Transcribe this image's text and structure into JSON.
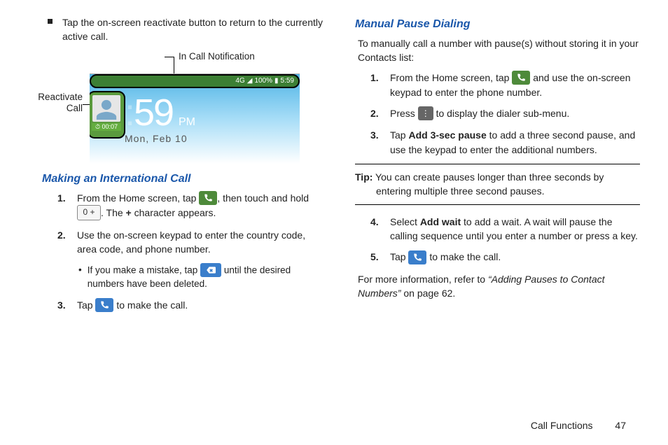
{
  "left": {
    "topBullet": "Tap the on-screen reactivate button to return to the currently active call.",
    "figure": {
      "callout_top": "In Call Notification",
      "callout_left_line1": "Reactivate",
      "callout_left_line2": "Call",
      "status_right": "100%",
      "status_time": "5:59",
      "status_4g": "4G",
      "timer": "00:07",
      "clock_partial": "59",
      "clock_pm": "PM",
      "clock_date": "Mon, Feb 10"
    },
    "heading": "Making an International Call",
    "steps": {
      "s1_a": "From the Home screen, tap ",
      "s1_b": ", then touch and hold ",
      "s1_c": ". The ",
      "s1_plus": "+",
      "s1_d": " character appears.",
      "key_0plus": "0 +",
      "s2": "Use the on-screen keypad to enter the country code, area code, and phone number.",
      "s2_sub_a": "If you make a mistake, tap ",
      "s2_sub_b": " until the desired numbers have been deleted.",
      "s3_a": "Tap ",
      "s3_b": " to make the call."
    }
  },
  "right": {
    "heading": "Manual Pause Dialing",
    "intro": "To manually call a number with pause(s) without storing it in your Contacts list:",
    "s1_a": "From the Home screen, tap ",
    "s1_b": " and use the on-screen keypad to enter the phone number.",
    "s2_a": "Press ",
    "s2_b": " to display the dialer sub-menu.",
    "s3_a": "Tap ",
    "s3_bold": "Add 3-sec pause",
    "s3_b": " to add a three second pause, and use the keypad to enter the additional numbers.",
    "tip_label": "Tip:",
    "tip_body_a": " You can create pauses longer than three seconds by",
    "tip_body_b": "entering multiple three second pauses.",
    "s4_a": "Select ",
    "s4_bold": "Add wait",
    "s4_b": " to add a wait. A wait will pause the calling sequence until you enter a number or press a key.",
    "s5_a": "Tap ",
    "s5_b": " to make the call.",
    "ref_a": "For more information, refer to ",
    "ref_italic": "“Adding Pauses to Contact Numbers” ",
    "ref_b": " on page 62."
  },
  "footer": {
    "section": "Call Functions",
    "page": "47"
  }
}
